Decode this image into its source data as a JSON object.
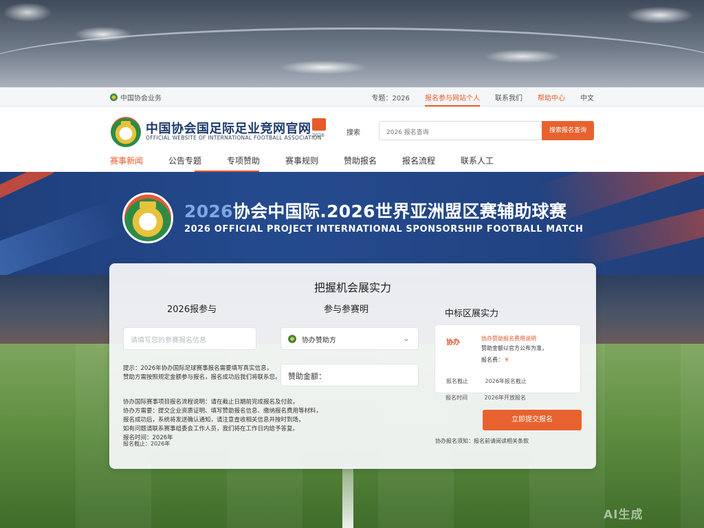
{
  "topbar": {
    "site_label": "中国协会业务",
    "links": [
      "专题：2026",
      "报名参与网站个人",
      "联系我们",
      "帮助中心",
      "中文"
    ]
  },
  "header": {
    "title": "中国协会国足际足业竞网官网",
    "subtitle": "OFFICIAL WEBSITE OF INTERNATIONAL FOOTBALL ASSOCIATION",
    "badge_label": "2026",
    "search_label": "搜索",
    "search_placeholder": "2026 报名查询",
    "search_button": "搜索报名查询"
  },
  "nav": {
    "items": [
      "赛事新闻",
      "公告专题",
      "专项赞助",
      "赛事规则",
      "赞助报名",
      "报名流程",
      "联系人工"
    ]
  },
  "hero": {
    "title_accent": "2026",
    "title": "协会中国际.2026世界亚洲盟区赛辅助球赛",
    "subtitle": "2026 OFFICIAL PROJECT INTERNATIONAL SPONSORSHIP FOOTBALL MATCH"
  },
  "form": {
    "title": "把握机会展实力",
    "col1_heading": "2026报参与",
    "col2_heading": "参与参赛明",
    "col3_heading": "中标区展实力",
    "name_placeholder": "请填写您的参赛报名信息",
    "select_value": "协办赞助方",
    "amount_value": "赞助金额：",
    "desc1": [
      "提示：2026年协办国际足球赛事报名需要填写真实信息，",
      "赞助方需按照规定金额参与报名，报名成功后我们将联系您。"
    ],
    "desc2": [
      "协办国际赛事项目报名流程说明：请在截止日期前完成报名及付款，",
      "协办方需要：提交企业资质证明、填写赞助报名信息、缴纳报名费用等材料，",
      "报名成功后，系统将发送确认通知，请注意查收相关信息并按时到场，",
      "如有问题请联系赛事组委会工作人员，我们将在工作日内给予答复。",
      "报名时间：2026年"
    ],
    "card": {
      "tag": "协办",
      "line1": "协办赞助报名费用说明",
      "line2": "赞助金额以官方公布为准，",
      "line3_label": "报名费：",
      "line3_price": "¥",
      "line4_label": "报名截止",
      "line4_value": "2026年报名截止"
    },
    "meta_label": "报名时间",
    "meta_value": "2026年开放报名",
    "submit": "立即提交报名",
    "footnote_right": "协办报名须知：报名前请阅读相关条款",
    "footnote_left": "报名截止：2026年"
  },
  "watermark": "AI生成",
  "colors": {
    "accent": "#e8622f",
    "hero_blue": "#244a8e",
    "title_blue": "#1e3a6e"
  }
}
